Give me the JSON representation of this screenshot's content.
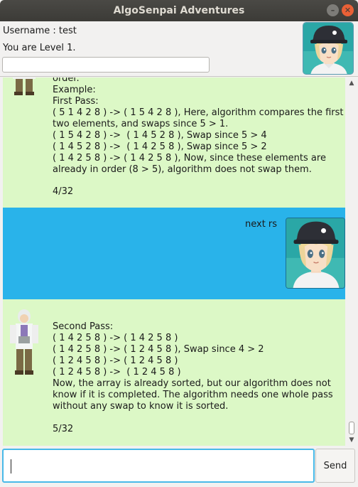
{
  "window": {
    "title": "AlgoSenpai Adventures"
  },
  "header": {
    "username_line": "Username : test",
    "level_line": "You are Level 1."
  },
  "chat": {
    "messages": [
      {
        "sender": "bot",
        "text": "order.\nExample:\nFirst Pass:\n( 5 1 4 2 8 ) -> ( 1 5 4 2 8 ), Here, algorithm compares the first\ntwo elements, and swaps since 5 > 1.\n( 1 5 4 2 8 ) ->  ( 1 4 5 2 8 ), Swap since 5 > 4\n( 1 4 5 2 8 ) ->  ( 1 4 2 5 8 ), Swap since 5 > 2\n( 1 4 2 5 8 ) -> ( 1 4 2 5 8 ), Now, since these elements are\nalready in order (8 > 5), algorithm does not swap them.",
        "counter": "4/32"
      },
      {
        "sender": "user",
        "text": "next rs"
      },
      {
        "sender": "bot",
        "text": "Second Pass:\n( 1 4 2 5 8 ) -> ( 1 4 2 5 8 )\n( 1 4 2 5 8 ) -> ( 1 2 4 5 8 ), Swap since 4 > 2\n( 1 2 4 5 8 ) -> ( 1 2 4 5 8 )\n( 1 2 4 5 8 ) ->  ( 1 2 4 5 8 )\nNow, the array is already sorted, but our algorithm does not\nknow if it is completed. The algorithm needs one whole pass\nwithout any swap to know it is sorted.",
        "counter": "5/32"
      }
    ]
  },
  "input": {
    "value": ""
  },
  "send": {
    "label": "Send"
  },
  "colors": {
    "bot_bubble": "#dcf8c6",
    "user_bubble": "#29b3ea",
    "input_focus": "#48b9e8"
  }
}
